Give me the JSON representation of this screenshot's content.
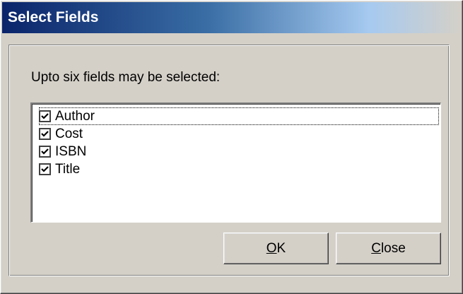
{
  "window": {
    "title": "Select Fields"
  },
  "dialog": {
    "prompt": "Upto six fields may be selected:"
  },
  "fields": [
    {
      "label": "Author",
      "checked": true,
      "focused": true
    },
    {
      "label": "Cost",
      "checked": true,
      "focused": false
    },
    {
      "label": "ISBN",
      "checked": true,
      "focused": false
    },
    {
      "label": "Title",
      "checked": true,
      "focused": false
    }
  ],
  "buttons": {
    "ok": {
      "mnemonic": "O",
      "rest": "K"
    },
    "close": {
      "mnemonic": "C",
      "rest": "lose"
    }
  },
  "colors": {
    "titlebar_start": "#0a246a",
    "titlebar_end": "#a6caf0",
    "dialog_face": "#d4d0c8"
  }
}
